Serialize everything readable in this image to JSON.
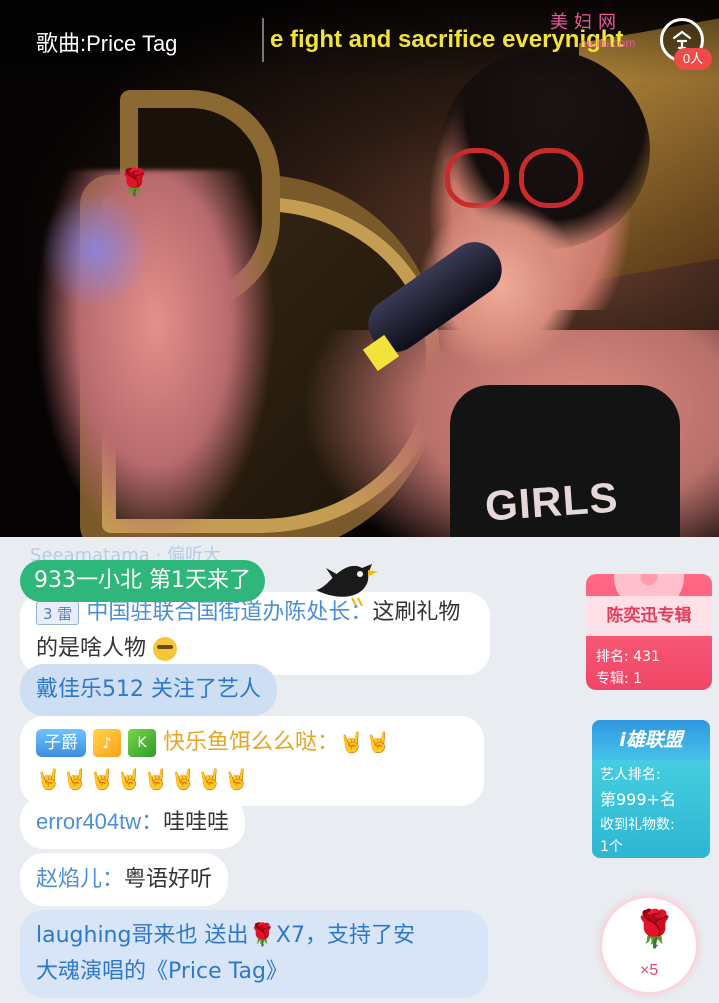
{
  "video": {
    "song_title": "歌曲:Price Tag",
    "lyric": "e fight and sacrifice everynight",
    "shirt_text": "GIRLS",
    "watermark_text": "美妇网",
    "watermark_url": "meifu.com",
    "viewer_count": "0人"
  },
  "chat": {
    "faded_text": "Seeamatama · 偏听大",
    "welcome_text": "933一小北 第1天来了",
    "messages": [
      {
        "level_badge": "3 雷",
        "user": "中国驻联合国街道办陈处长",
        "separator": "：",
        "text": "这刷礼物的是啥人物"
      },
      {
        "text": "戴佳乐512 关注了艺人"
      },
      {
        "title_badge": "子爵",
        "badge_sq": "♪",
        "badge_k": "K",
        "user": "快乐鱼饵么么哒",
        "separator": "：",
        "emojis_line1": "🤘🤘",
        "emojis_line2": "🤘🤘🤘🤘🤘🤘🤘🤘"
      },
      {
        "user": "error404tw",
        "separator": "：",
        "text": "哇哇哇"
      },
      {
        "user": "赵焰儿",
        "separator": "：",
        "text": "粤语好听"
      },
      {
        "line1_prefix": "laughing哥来也 送出",
        "gift_icon": "rose-icon",
        "line1_suffix": "X7，支持了安",
        "line2": "大魂演唱的《Price Tag》"
      }
    ]
  },
  "album_card": {
    "title": "陈奕迅专辑",
    "rank_label": "排名: 431",
    "album_label": "专辑: 1"
  },
  "union_card": {
    "title": "i雄联盟",
    "rank_label": "艺人排名:",
    "rank_value": "第999+名",
    "gift_label": "收到礼物数:",
    "gift_value": "1个"
  },
  "gift_button": {
    "icon": "rose-icon",
    "count": "×5"
  },
  "colors": {
    "lyric": "#f1e33a",
    "welcome_bg": "#2fb67b",
    "username": "#4a8fd8",
    "album_card": "#ef4665",
    "union_card": "#2db6d2"
  }
}
